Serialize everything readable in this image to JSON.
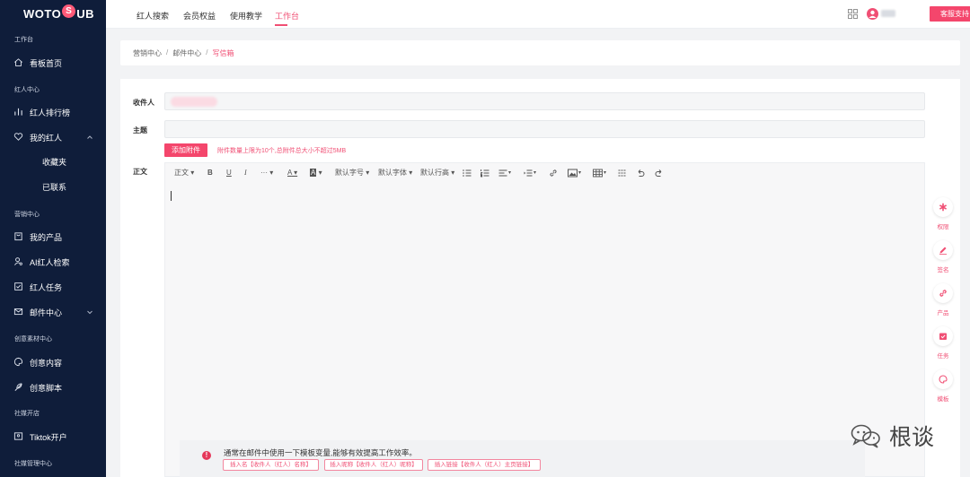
{
  "logo": {
    "left": "WOTO",
    "badge": "S",
    "right": "UB"
  },
  "sidebar": {
    "sections": {
      "workbench": "工作台",
      "influencer_center": "红人中心",
      "marketing_center": "营销中心",
      "creative_center": "创意素材中心",
      "social": "社媒开店",
      "social_manage": "社媒管理中心"
    },
    "items": {
      "dashboard": "看板首页",
      "ranking": "红人排行榜",
      "my_influencers": "我的红人",
      "favorites": "收藏夹",
      "contacted": "已联系",
      "my_products": "我的产品",
      "ai_search": "AI红人检索",
      "tasks": "红人任务",
      "mail_center": "邮件中心",
      "creative_content": "创意内容",
      "creative_script": "创意脚本",
      "tiktok_shop": "Tiktok开户"
    }
  },
  "topbar": {
    "tabs": [
      "红人搜索",
      "会员权益",
      "使用教学",
      "工作台"
    ],
    "active_tab": "工作台",
    "service_button": "客服支持"
  },
  "breadcrumb": {
    "items": [
      "营销中心",
      "邮件中心",
      "写信箱"
    ],
    "separator": "/"
  },
  "form": {
    "recipient_label": "收件人",
    "subject_label": "主题",
    "attach_button": "添加附件",
    "attach_hint": "附件数量上限为10个,总附件总大小不超过5MB",
    "body_label": "正文"
  },
  "toolbar": {
    "paragraph": "正文",
    "bold": "B",
    "underline": "U",
    "italic": "I",
    "more": "···",
    "fontcolor": "A",
    "bgcolor": "A",
    "fontsize": "默认字号",
    "fontfamily": "默认字体",
    "lineheight": "默认行高"
  },
  "tips": {
    "icon": "!",
    "text": "通常在邮件中使用一下模板变量,能够有效提高工作效率。",
    "vars": [
      "插入名【收件人（红人）名称】",
      "插入昵称【收件人（红人）昵称】",
      "插入链接【收件人（红人）主页链接】"
    ]
  },
  "right_tools": [
    "权限",
    "签名",
    "产品",
    "任务",
    "模板"
  ],
  "watermark": "根谈",
  "colors": {
    "accent": "#f04f74",
    "sidebar_bg": "#0f1d3a",
    "button": "#f4466c"
  }
}
